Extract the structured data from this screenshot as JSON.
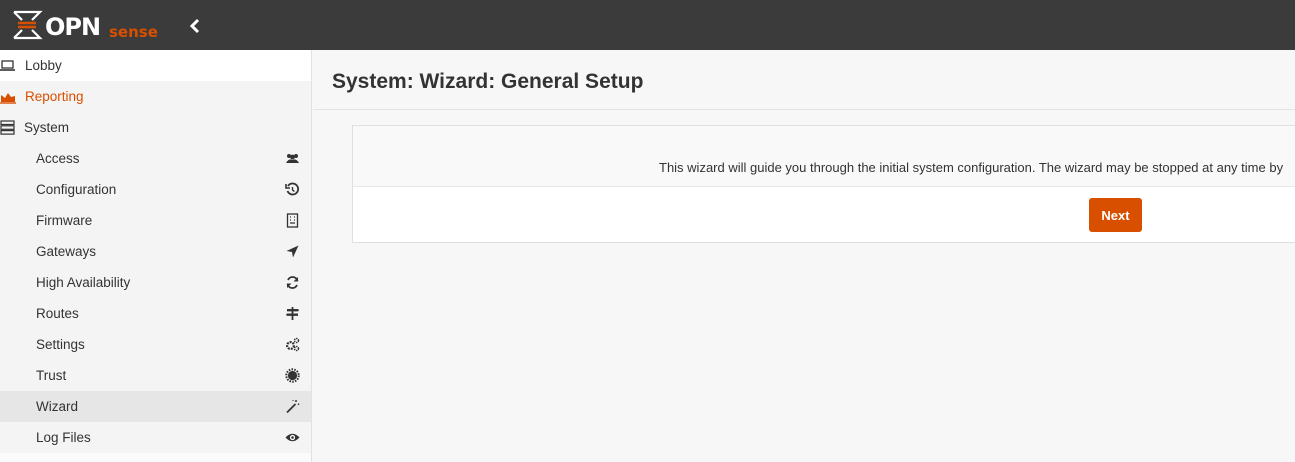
{
  "brand": {
    "name": "OPNsense",
    "logo_text_main": "OPN",
    "logo_text_sub": "sense",
    "accent_color": "#d94f00",
    "header_color": "#3b3b3b"
  },
  "topbar": {
    "collapse_icon": "chevron-left-icon"
  },
  "sidebar": {
    "lobby": {
      "label": "Lobby",
      "icon": "laptop-icon"
    },
    "reporting": {
      "label": "Reporting",
      "icon": "area-chart-icon"
    },
    "system": {
      "label": "System",
      "icon": "server-icon"
    },
    "items": [
      {
        "label": "Access",
        "icon": "users-icon"
      },
      {
        "label": "Configuration",
        "icon": "history-icon"
      },
      {
        "label": "Firmware",
        "icon": "building-icon"
      },
      {
        "label": "Gateways",
        "icon": "location-arrow-icon"
      },
      {
        "label": "High Availability",
        "icon": "refresh-icon"
      },
      {
        "label": "Routes",
        "icon": "map-signs-icon"
      },
      {
        "label": "Settings",
        "icon": "cogs-icon"
      },
      {
        "label": "Trust",
        "icon": "certificate-icon"
      },
      {
        "label": "Wizard",
        "icon": "magic-icon"
      },
      {
        "label": "Log Files",
        "icon": "eye-icon"
      }
    ],
    "active_item": "Wizard"
  },
  "page": {
    "title": "System: Wizard: General Setup",
    "intro_text": "This wizard will guide you through the initial system configuration. The wizard may be stopped at any time by",
    "next_label": "Next"
  }
}
